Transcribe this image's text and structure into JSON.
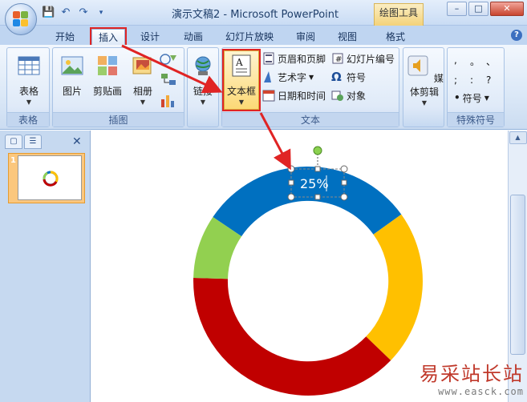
{
  "window": {
    "title": "演示文稿2 - Microsoft PowerPoint",
    "contextual_tab": "绘图工具",
    "controls": [
      "–",
      "□",
      "✕"
    ]
  },
  "tabs": [
    "开始",
    "插入",
    "设计",
    "动画",
    "幻灯片放映",
    "审阅",
    "视图",
    "格式"
  ],
  "active_tab": "插入",
  "help": "?",
  "ribbon": {
    "groups": {
      "table": "表格",
      "illustrations": "插图",
      "text": "文本",
      "special_symbols": "特殊符号"
    },
    "buttons": {
      "table": "表格",
      "picture": "图片",
      "clipart": "剪贴画",
      "album": "相册",
      "link": "链接",
      "textbox": "文本框",
      "header_footer": "页眉和页脚",
      "wordart": "艺术字",
      "datetime": "日期和时间",
      "slide_number": "幻灯片编号",
      "symbol": "符号",
      "object": "对象",
      "media": "媒体剪辑",
      "special_symbol": "符号"
    },
    "special_chars": [
      ",",
      "。",
      "、",
      ";",
      ":",
      "?"
    ]
  },
  "slides_pane": {
    "slide_number": "1"
  },
  "slide": {
    "textbox_text": "25%",
    "colors": {
      "blue": "#0070c0",
      "yellow": "#ffc000",
      "red": "#c00000",
      "green": "#92d050"
    }
  },
  "watermark": {
    "site_name": "易采站长站",
    "url": "www.easck.com"
  }
}
